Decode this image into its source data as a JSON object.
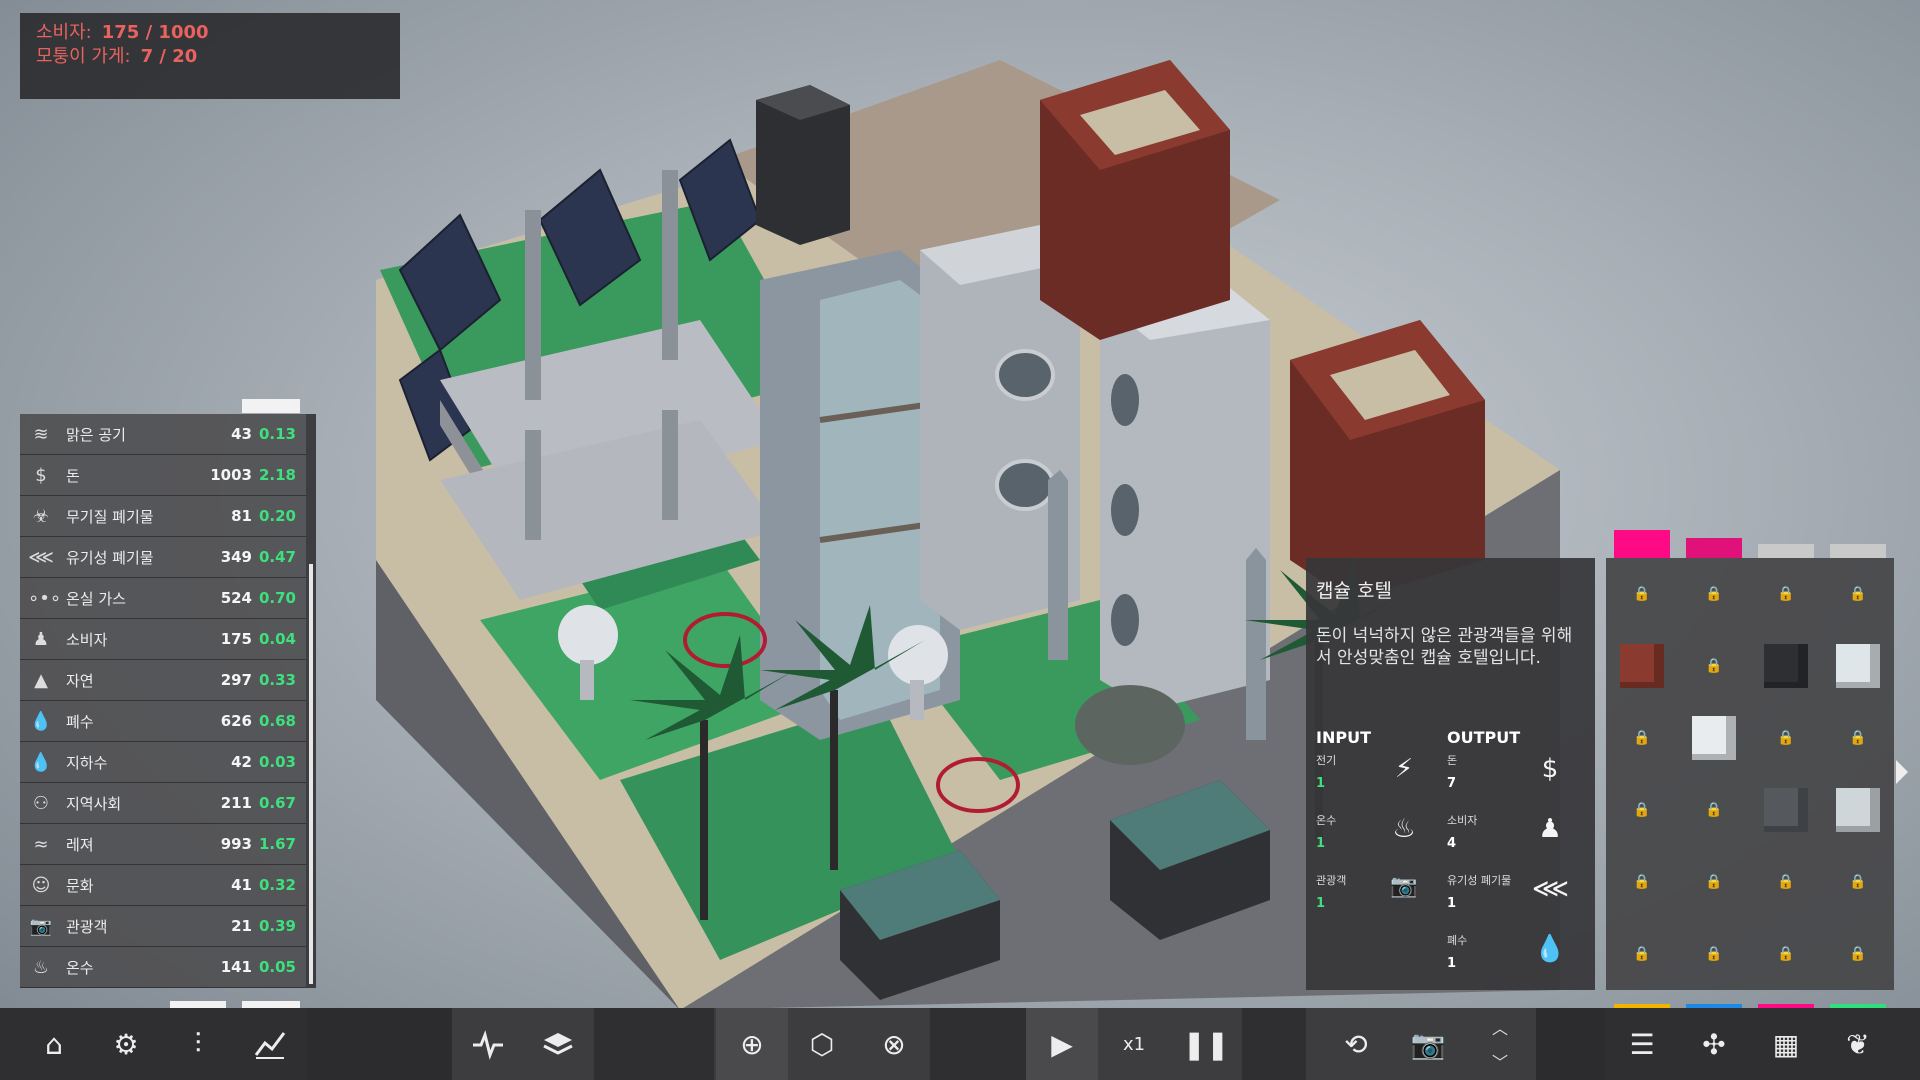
{
  "counters": {
    "consumers_label": "소비자:",
    "consumers_value": "175 / 1000",
    "shops_label": "모퉁이 가게:",
    "shops_value": "7 / 20"
  },
  "resources": [
    {
      "icon": "wind-icon",
      "glyph": "≋",
      "name": "맑은 공기",
      "value": "43",
      "delta": "0.13"
    },
    {
      "icon": "money-icon",
      "glyph": "$",
      "name": "돈",
      "value": "1003",
      "delta": "2.18"
    },
    {
      "icon": "biohazard-icon",
      "glyph": "☣",
      "name": "무기질 폐기물",
      "value": "81",
      "delta": "0.20"
    },
    {
      "icon": "fishbone-icon",
      "glyph": "⋘",
      "name": "유기성 폐기물",
      "value": "349",
      "delta": "0.47"
    },
    {
      "icon": "gas-molecule-icon",
      "glyph": "∘•∘",
      "name": "온실 가스",
      "value": "524",
      "delta": "0.70"
    },
    {
      "icon": "consumer-icon",
      "glyph": "♟",
      "name": "소비자",
      "value": "175",
      "delta": "0.04"
    },
    {
      "icon": "mountain-icon",
      "glyph": "▲",
      "name": "자연",
      "value": "297",
      "delta": "0.33"
    },
    {
      "icon": "waste-water-icon",
      "glyph": "💧",
      "name": "폐수",
      "value": "626",
      "delta": "0.68"
    },
    {
      "icon": "groundwater-icon",
      "glyph": "💧",
      "name": "지하수",
      "value": "42",
      "delta": "0.03"
    },
    {
      "icon": "community-icon",
      "glyph": "⚇",
      "name": "지역사회",
      "value": "211",
      "delta": "0.67"
    },
    {
      "icon": "leisure-icon",
      "glyph": "≈",
      "name": "레져",
      "value": "993",
      "delta": "1.67"
    },
    {
      "icon": "theatre-masks-icon",
      "glyph": "☺",
      "name": "문화",
      "value": "41",
      "delta": "0.32"
    },
    {
      "icon": "camera-icon",
      "glyph": "📷",
      "name": "관광객",
      "value": "21",
      "delta": "0.39"
    },
    {
      "icon": "hot-spring-icon",
      "glyph": "♨",
      "name": "온수",
      "value": "141",
      "delta": "0.05"
    }
  ],
  "info": {
    "title": "캡슐 호텔",
    "description": "돈이 넉넉하지 않은 관광객들을 위해서 안성맞춤인 캡슐 호텔입니다.",
    "input_label": "INPUT",
    "output_label": "OUTPUT",
    "inputs": [
      {
        "name": "전기",
        "value": "1",
        "icon": "lightning-icon"
      },
      {
        "name": "온수",
        "value": "1",
        "icon": "hot-spring-icon"
      },
      {
        "name": "관광객",
        "value": "1",
        "icon": "camera-icon"
      }
    ],
    "outputs": [
      {
        "name": "돈",
        "value": "7",
        "icon": "money-icon"
      },
      {
        "name": "소비자",
        "value": "4",
        "icon": "consumer-icon"
      },
      {
        "name": "유기성 폐기물",
        "value": "1",
        "icon": "fishbone-icon"
      },
      {
        "name": "폐수",
        "value": "1",
        "icon": "waste-water-icon"
      }
    ]
  },
  "palette": {
    "tab_colors": [
      "#ff0a85",
      "#e0127a",
      "#c9c9c9",
      "#c9c9c9"
    ],
    "strip_colors": [
      "#f2b400",
      "#1e88e5",
      "#ff0a85",
      "#2ee07d"
    ]
  },
  "toolbar": {
    "speed": "x1"
  },
  "colors": {
    "accent_red": "#e8625f",
    "delta_green": "#3ee07d",
    "magenta": "#ff0a85"
  }
}
